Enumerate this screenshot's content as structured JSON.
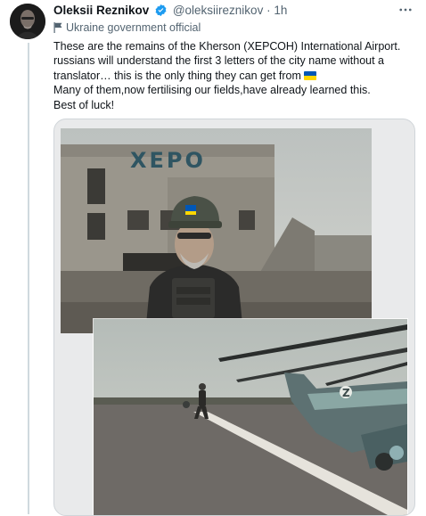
{
  "author": {
    "name": "Oleksii Reznikov",
    "handle": "@oleksiireznikov",
    "separator": "·",
    "time": "1h",
    "label": "Ukraine government official"
  },
  "tweet": {
    "line1": "These are the remains of the Kherson (ХЕРСОН) International Airport.",
    "line2": "russians will understand the first 3 letters of the city name without a",
    "line3": "translator… this is the only thing they can get from",
    "line4": "Many of them,now fertilising our fields,have already learned this.",
    "line5": "Best of luck!"
  },
  "media": {
    "sign_text": "ХЕРО"
  },
  "colors": {
    "accent": "#1d9bf0",
    "flag_blue": "#0057b7",
    "flag_yellow": "#ffd700"
  },
  "icons": {
    "verified": "verified-badge-icon",
    "label": "government-flag-icon",
    "more": "more-horizontal-icon"
  }
}
